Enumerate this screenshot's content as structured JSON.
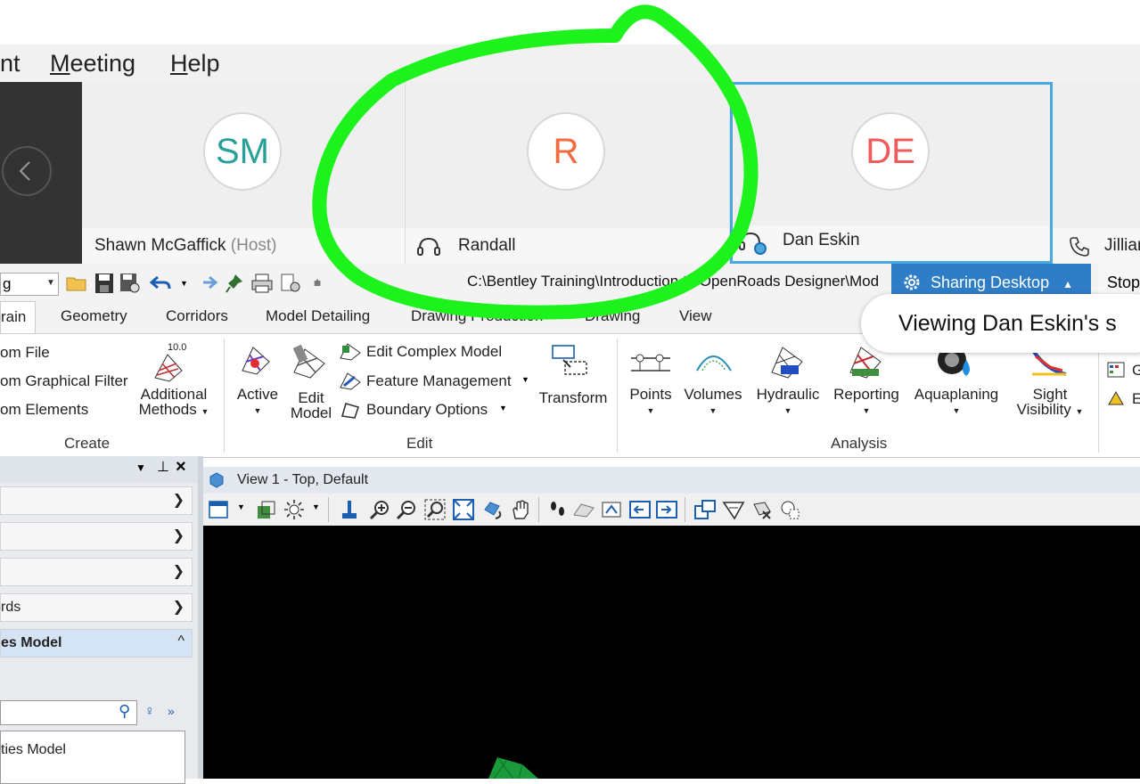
{
  "meeting": {
    "menu": [
      "nt",
      "Meeting",
      "Help"
    ],
    "participants": [
      {
        "initials": "SM",
        "name": "Shawn McGaffick",
        "role": "(Host)",
        "color": "#2aa198"
      },
      {
        "initials": "R",
        "name": "Randall",
        "color": "#f26a3d"
      },
      {
        "initials": "DE",
        "name": "Dan Eskin",
        "color": "#f05a5a"
      },
      {
        "name": "Jillian"
      }
    ],
    "sharing_label": "Sharing Desktop",
    "stop_label": "Stop",
    "viewing_toast": "Viewing Dan Eskin's s"
  },
  "app": {
    "workspace_value": "g",
    "title": "C:\\Bentley Training\\Introduction to OpenRoads Designer\\Mod",
    "tabs": [
      "rain",
      "Geometry",
      "Corridors",
      "Model Detailing",
      "Drawing Production",
      "Drawing",
      "View"
    ],
    "ribbon": {
      "create": {
        "items": [
          "om File",
          "om Graphical Filter",
          "om Elements"
        ],
        "additional": "Additional",
        "methods": "Methods",
        "badge": "10.0",
        "group": "Create"
      },
      "edit": {
        "active": "Active",
        "edit_model_1": "Edit",
        "edit_model_2": "Model",
        "edit_complex": "Edit Complex Model",
        "feature_mgmt": "Feature Management",
        "boundary": "Boundary Options",
        "transform": "Transform",
        "group": "Edit"
      },
      "analysis": {
        "points": "Points",
        "volumes": "Volumes",
        "hydraulic": "Hydraulic",
        "reporting": "Reporting",
        "aquaplaning": "Aquaplaning",
        "sight_1": "Sight",
        "sight_2": "Visibility",
        "group": "Analysis",
        "next_1": "G",
        "next_2": "E"
      }
    },
    "panel": {
      "sections": [
        "",
        "",
        "",
        "rds",
        "es Model"
      ],
      "tree_item": "ties Model"
    },
    "view": {
      "title": "View 1 - Top, Default"
    }
  }
}
